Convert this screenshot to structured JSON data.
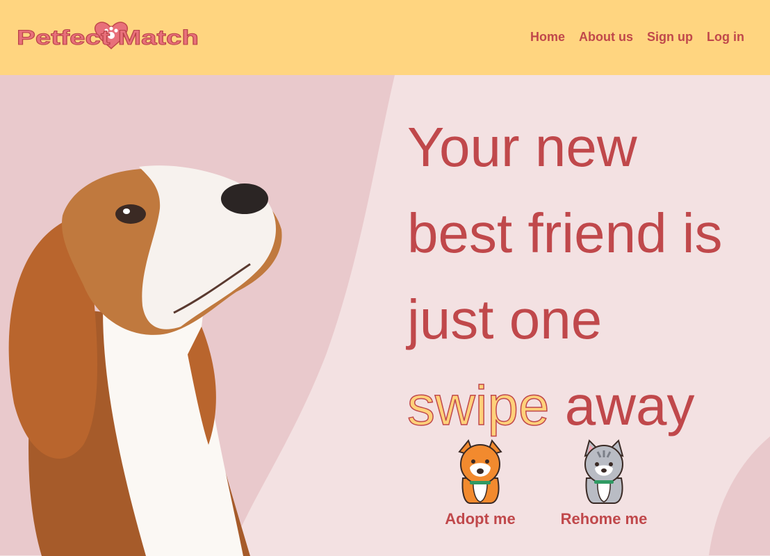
{
  "header": {
    "logo_text": "Petfect Match",
    "nav": [
      {
        "label": "Home"
      },
      {
        "label": "About us"
      },
      {
        "label": "Sign up"
      },
      {
        "label": "Log in"
      }
    ]
  },
  "hero": {
    "line1": "Your new",
    "line2": "best friend is",
    "line3": "just one",
    "highlight": "swipe",
    "line4_rest": " away"
  },
  "actions": [
    {
      "label": "Adopt me",
      "icon": "dog-icon"
    },
    {
      "label": "Rehome me",
      "icon": "cat-icon"
    }
  ],
  "colors": {
    "header_bg": "#ffd580",
    "accent": "#c0484b",
    "highlight": "#ffd17a",
    "panel_left": "#e9c9cc",
    "panel_right": "#f3e1e2"
  }
}
